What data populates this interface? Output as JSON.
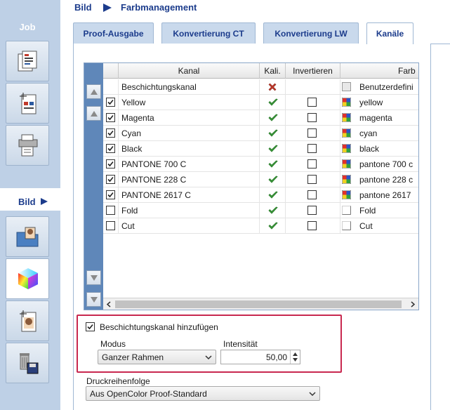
{
  "breadcrumb": {
    "section": "Bild",
    "page": "Farbmanagement"
  },
  "sidebar": {
    "job_label": "Job",
    "bild_label": "Bild",
    "job_buttons": [
      {
        "icon": "job-list-icon"
      },
      {
        "icon": "job-layout-icon"
      },
      {
        "icon": "printer-icon"
      }
    ],
    "bild_buttons": [
      {
        "icon": "image-folder-icon"
      },
      {
        "icon": "color-cube-icon"
      },
      {
        "icon": "image-layout-icon"
      },
      {
        "icon": "trash-save-icon"
      }
    ]
  },
  "tabs": [
    {
      "label": "Proof-Ausgabe",
      "active": false
    },
    {
      "label": "Konvertierung CT",
      "active": false
    },
    {
      "label": "Konvertierung LW",
      "active": false
    },
    {
      "label": "Kanäle",
      "active": true
    }
  ],
  "table": {
    "headers": [
      "",
      "Kanal",
      "Kali.",
      "Invertieren",
      "Farb"
    ],
    "rows": [
      {
        "checked": null,
        "name": "Beschichtungskanal",
        "kali": "cross",
        "invert": null,
        "swatch": "plain",
        "color": "Benutzerdefini"
      },
      {
        "checked": true,
        "name": "Yellow",
        "kali": "check",
        "invert": false,
        "swatch": "multi",
        "color": "yellow"
      },
      {
        "checked": true,
        "name": "Magenta",
        "kali": "check",
        "invert": false,
        "swatch": "multi",
        "color": "magenta"
      },
      {
        "checked": true,
        "name": "Cyan",
        "kali": "check",
        "invert": false,
        "swatch": "multi",
        "color": "cyan"
      },
      {
        "checked": true,
        "name": "Black",
        "kali": "check",
        "invert": false,
        "swatch": "multi",
        "color": "black"
      },
      {
        "checked": true,
        "name": "PANTONE 700 C",
        "kali": "check",
        "invert": false,
        "swatch": "multi",
        "color": "pantone 700 c"
      },
      {
        "checked": true,
        "name": "PANTONE 228 C",
        "kali": "check",
        "invert": false,
        "swatch": "multi",
        "color": "pantone 228 c"
      },
      {
        "checked": true,
        "name": "PANTONE 2617 C",
        "kali": "check",
        "invert": false,
        "swatch": "multi",
        "color": "pantone 2617"
      },
      {
        "checked": false,
        "name": "Fold",
        "kali": "check",
        "invert": false,
        "swatch": "blank",
        "color": "Fold"
      },
      {
        "checked": false,
        "name": "Cut",
        "kali": "check",
        "invert": false,
        "swatch": "blank",
        "color": "Cut"
      }
    ]
  },
  "coating": {
    "checkbox_label": "Beschichtungskanal hinzufügen",
    "checked": true,
    "modus_label": "Modus",
    "modus_value": "Ganzer Rahmen",
    "intensity_label": "Intensität",
    "intensity_value": "50,00"
  },
  "print_order": {
    "label": "Druckreihenfolge",
    "value": "Aus OpenColor Proof-Standard"
  },
  "colors": {
    "accent": "#1c3c8c",
    "sidebar_bg": "#bed0e6",
    "table_sidebar": "#5f87b9",
    "highlight": "#c8284f",
    "check_green": "#3a9a3a",
    "cross_red": "#c0392b"
  }
}
